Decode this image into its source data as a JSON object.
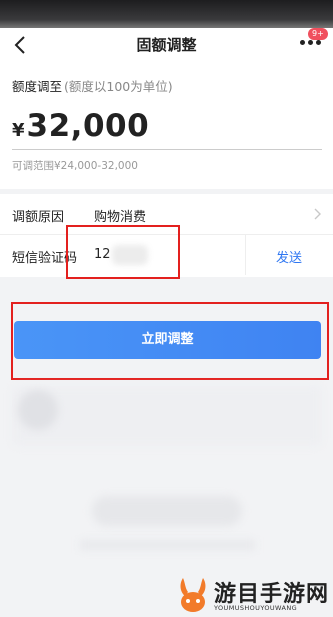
{
  "header": {
    "title": "固额调整",
    "badge": "9+"
  },
  "adjust": {
    "label": "额度调至",
    "hint": "(额度以100为单位)",
    "currency": "¥",
    "amount": "32,000",
    "range": "可调范围¥24,000-32,000"
  },
  "form": {
    "reason_label": "调额原因",
    "reason_value": "购物消费",
    "sms_label": "短信验证码",
    "sms_value": "12",
    "send_label": "发送"
  },
  "confirm_label": "立即调整",
  "watermark": {
    "title": "游目手游网",
    "subtitle": "YOUMUSHOUYOUWANG"
  },
  "colors": {
    "accent": "#3f83f2",
    "highlight": "#e3201e",
    "badge": "#f0505e"
  }
}
